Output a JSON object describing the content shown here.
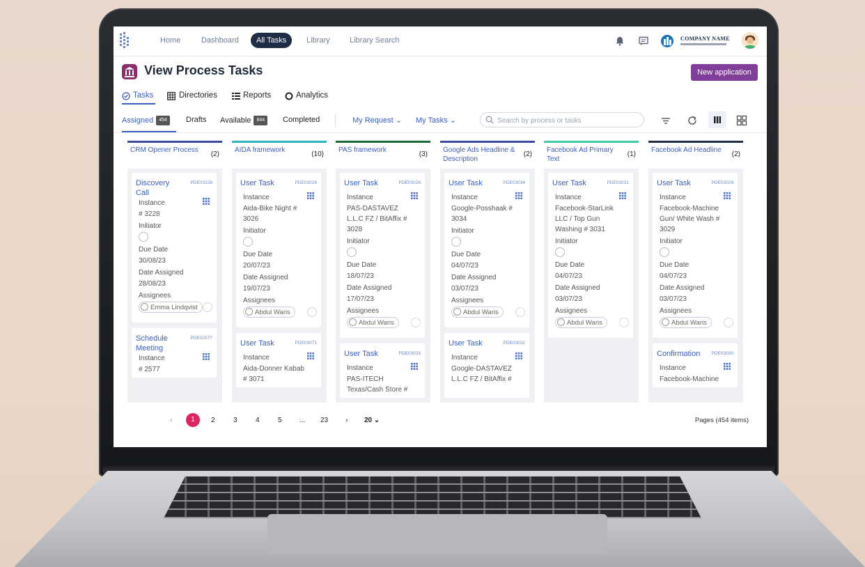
{
  "topnav": {
    "links": [
      "Home",
      "Dashboard",
      "All Tasks",
      "Library",
      "Library Search"
    ],
    "active": "All Tasks",
    "company": "COMPANY NAME"
  },
  "page": {
    "title": "View Process Tasks",
    "new_button": "New application"
  },
  "subtabs": [
    "Tasks",
    "Directories",
    "Reports",
    "Analytics"
  ],
  "filters": {
    "assigned": "Assigned",
    "assigned_count": "454",
    "drafts": "Drafts",
    "available": "Available",
    "available_count": "844",
    "completed": "Completed",
    "my_request": "My Request",
    "my_tasks": "My Tasks",
    "search_placeholder": "Search by process or tasks"
  },
  "colors": {
    "accent": "#3b5fc0",
    "nav_pill": "#1e2c46",
    "primary_button": "#7f3f98",
    "pagination_active": "#e0245e"
  },
  "columns": [
    {
      "name": "CRM Opener Process",
      "count": "(2)",
      "color": "#3b4a9a",
      "cards": [
        {
          "title": "Discovery Call",
          "id": "PDE03228",
          "instance": "# 3228",
          "due": "30/08/23",
          "assigned": "28/08/23",
          "assignee": "Emma Lindqvist"
        },
        {
          "title": "Schedule Meeting",
          "id": "PDE02577",
          "instance": "# 2577"
        }
      ]
    },
    {
      "name": "AIDA framework",
      "count": "(10)",
      "color": "#2fb3c4",
      "cards": [
        {
          "title": "User Task",
          "id": "PDE03026",
          "instance": "Aida-Bike Night # 3026",
          "due": "20/07/23",
          "assigned": "19/07/23",
          "assignee": "Abdul Waris"
        },
        {
          "title": "User Task",
          "id": "PDE03071",
          "instance": "Aida-Donner Kabab # 3071"
        }
      ]
    },
    {
      "name": "PAS framework",
      "count": "(3)",
      "color": "#1e6b3a",
      "cards": [
        {
          "title": "User Task",
          "id": "PDE03028",
          "instance": "PAS-DASTAVEZ L.L.C FZ / BitAffix # 3028",
          "due": "18/07/23",
          "assigned": "17/07/23",
          "assignee": "Abdul Waris"
        },
        {
          "title": "User Task",
          "id": "PDE03033",
          "instance": "PAS-ITECH Texas/Cash Store #"
        }
      ]
    },
    {
      "name": "Google Ads Headline & Description",
      "count": "(2)",
      "color": "#3b4a9a",
      "cards": [
        {
          "title": "User Task",
          "id": "PDE03034",
          "instance": "Google-Posshaak # 3034",
          "due": "04/07/23",
          "assigned": "03/07/23",
          "assignee": "Abdul Waris"
        },
        {
          "title": "User Task",
          "id": "PDE03032",
          "instance": "Google-DASTAVEZ L.L.C FZ / BitAffix #"
        }
      ]
    },
    {
      "name": "Facebook Ad Primary Text",
      "count": "(1)",
      "color": "#3fc9a8",
      "cards": [
        {
          "title": "User Task",
          "id": "PDE03031",
          "instance": "Facebook-StarLink LLC / Top Gun Washing # 3031",
          "due": "04/07/23",
          "assigned": "03/07/23",
          "assignee": "Abdul Waris"
        }
      ]
    },
    {
      "name": "Facebook Ad Headline",
      "count": "(2)",
      "color": "#1e2c46",
      "cards": [
        {
          "title": "User Task",
          "id": "PDE03029",
          "instance": "Facebook-Machine Gun/ White Wash # 3029",
          "due": "04/07/23",
          "assigned": "03/07/23",
          "assignee": "Abdul Waris"
        },
        {
          "title": "Confirmation",
          "id": "PDE03030",
          "instance": "Facebook-Machine"
        }
      ]
    }
  ],
  "labels": {
    "instance": "Instance",
    "initiator": "Initiator",
    "due_date": "Due Date",
    "date_assigned": "Date Assigned",
    "assignees": "Assignees"
  },
  "pagination": {
    "pages": [
      "1",
      "2",
      "3",
      "4",
      "5",
      "...",
      "23"
    ],
    "per_page": "20",
    "info": "Pages (454 items)"
  }
}
